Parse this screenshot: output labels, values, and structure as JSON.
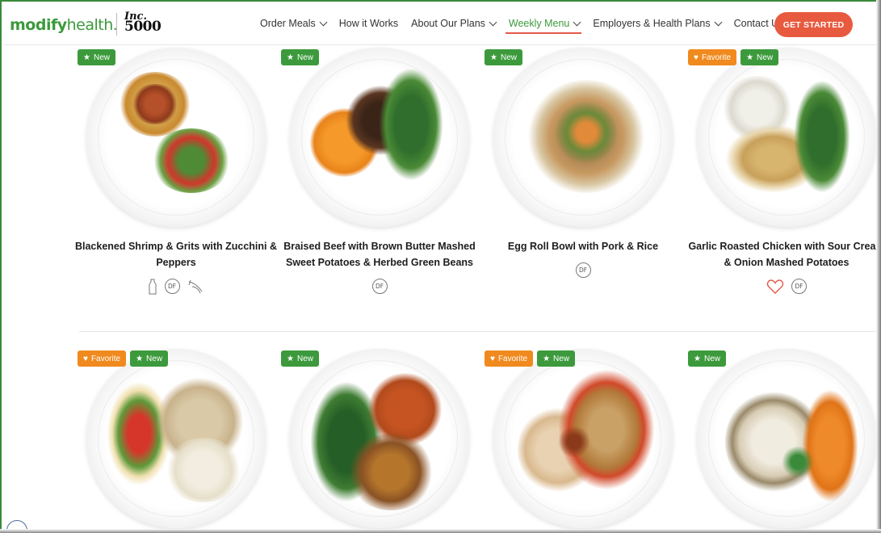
{
  "header": {
    "logo_bold": "modify",
    "logo_light": "health.",
    "inc_line1": "Inc.",
    "inc_line2": "5000",
    "nav": [
      {
        "label": "Order Meals",
        "dropdown": true,
        "active": false
      },
      {
        "label": "How it Works",
        "dropdown": false,
        "active": false
      },
      {
        "label": "About Our Plans",
        "dropdown": true,
        "active": false
      },
      {
        "label": "Weekly Menu",
        "dropdown": true,
        "active": true
      },
      {
        "label": "Employers & Health Plans",
        "dropdown": true,
        "active": false
      },
      {
        "label": "Contact Us",
        "dropdown": false,
        "active": false
      }
    ],
    "cta_label": "GET STARTED"
  },
  "badge_text": {
    "new": "New",
    "favorite": "Favorite"
  },
  "meals_row1": [
    {
      "title": "Blackened Shrimp & Grits with Zucchini & Peppers",
      "badges": [
        "new"
      ],
      "tags": [
        "milk-icon",
        "DF",
        "fish-icon"
      ]
    },
    {
      "title": "Braised Beef with Brown Butter Mashed Sweet Potatoes & Herbed Green Beans",
      "badges": [
        "new"
      ],
      "tags": [
        "DF"
      ]
    },
    {
      "title": "Egg Roll Bowl with Pork & Rice",
      "badges": [
        "new"
      ],
      "tags": [
        "DF"
      ]
    },
    {
      "title": "Garlic Roasted Chicken with Sour Cream & Onion Mashed Potatoes",
      "badges": [
        "favorite",
        "new"
      ],
      "tags": [
        "heart-icon",
        "DF"
      ]
    }
  ],
  "meals_row2": [
    {
      "badges": [
        "favorite",
        "new"
      ]
    },
    {
      "badges": [
        "new"
      ]
    },
    {
      "badges": [
        "favorite",
        "new"
      ]
    },
    {
      "badges": [
        "new"
      ]
    }
  ],
  "df_label": "DF",
  "colors": {
    "brand_green": "#3c9a3c",
    "cta_orange": "#e85a3f",
    "favorite_orange": "#f08a1e"
  }
}
